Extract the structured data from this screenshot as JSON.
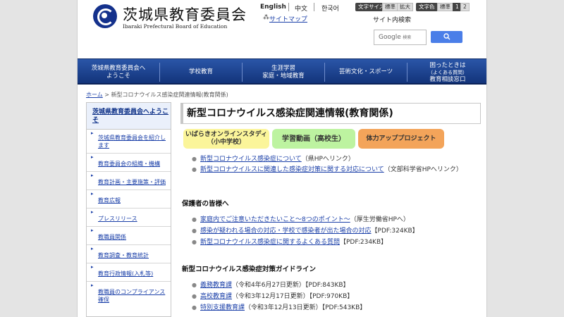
{
  "header": {
    "logo_title": "茨城県教育委員会",
    "logo_subtitle": "Ibaraki Prefectural Board of Education",
    "languages": [
      "English",
      "中文",
      "한국어"
    ],
    "text_size_label": "文字サイズ",
    "text_size_standard": "標準",
    "text_size_large": "拡大",
    "text_color_label": "文字色",
    "text_color_standard": "標準",
    "text_color_1": "1",
    "text_color_2": "2",
    "sitemap_icon": "sitemap-icon",
    "sitemap": "サイトマップ",
    "site_search_label": "サイト内検索",
    "search_brand": "Google",
    "search_placeholder": "検索",
    "search_button_icon": "search-icon"
  },
  "nav": {
    "items": [
      {
        "line1": "茨城県教育委員会へ",
        "line2": "ようこそ"
      },
      {
        "line1": "学校教育",
        "line2": ""
      },
      {
        "line1": "生涯学習",
        "line2": "家庭・地域教育"
      },
      {
        "line1": "芸術文化・スポーツ",
        "line2": ""
      },
      {
        "line1": "困ったときは",
        "line2": "（よくある質問）",
        "line3": "教育相談窓口"
      }
    ]
  },
  "breadcrumb": {
    "home": "ホーム",
    "separator": " > ",
    "current": "新型コロナウイルス感染症関連情報(教育関係)"
  },
  "sidebar": {
    "heading": "茨城県教育委員会へようこそ",
    "items": [
      {
        "label": "茨城県教育委員会を紹介します"
      },
      {
        "label": "教育委員会の組織・機構"
      },
      {
        "label": "教育計画・主要施策・評価"
      },
      {
        "label": "教育広報"
      },
      {
        "label": "プレスリリース"
      },
      {
        "label": "教職員関係"
      },
      {
        "label": "教育調査・教育統計"
      },
      {
        "label": "教育行政情報(入札等)"
      },
      {
        "label": "教職員のコンプライアンス確保"
      }
    ]
  },
  "main": {
    "title": "新型コロナウイルス感染症関連情報(教育関係)",
    "tabs": [
      {
        "line1": "いばらきオンラインスタディ",
        "line2": "（小中学校）",
        "color": "#fbf59a"
      },
      {
        "line1": "学習動画（高校生）",
        "line2": "",
        "color": "#bdf3a0"
      },
      {
        "line1": "体力アッププロジェクト",
        "line2": "",
        "color": "#f3a45a"
      }
    ],
    "top_links": [
      {
        "text": "新型コロナウイルス感染症について",
        "note": "（県HPへリンク）"
      },
      {
        "text": "新型コロナウイルスに関連した感染症対策に関する対応について",
        "note": "（文部科学省HPへリンク）"
      }
    ],
    "guardians": {
      "heading": "保護者の皆様へ",
      "links": [
        {
          "text": "家庭内でご注意いただきたいこと～8つのポイント～",
          "note": "（厚生労働省HPへ）"
        },
        {
          "text": "感染が疑われる場合の対応・学校で感染者が出た場合の対応",
          "note": "【PDF:324KB】"
        },
        {
          "text": "新型コロナウイルス感染症に関するよくある質問",
          "note": "【PDF:234KB】"
        }
      ]
    },
    "guidelines": {
      "heading": "新型コロナウイルス感染症対策ガイドライン",
      "links": [
        {
          "text": "義務教育課",
          "note": "（令和4年6月27日更新）【PDF:843KB】"
        },
        {
          "text": "高校教育課",
          "note": "（令和3年12月17日更新）【PDF:970KB】"
        },
        {
          "text": "特別支援教育課",
          "note": "（令和3年12月13日更新）【PDF:543KB】"
        }
      ]
    }
  }
}
